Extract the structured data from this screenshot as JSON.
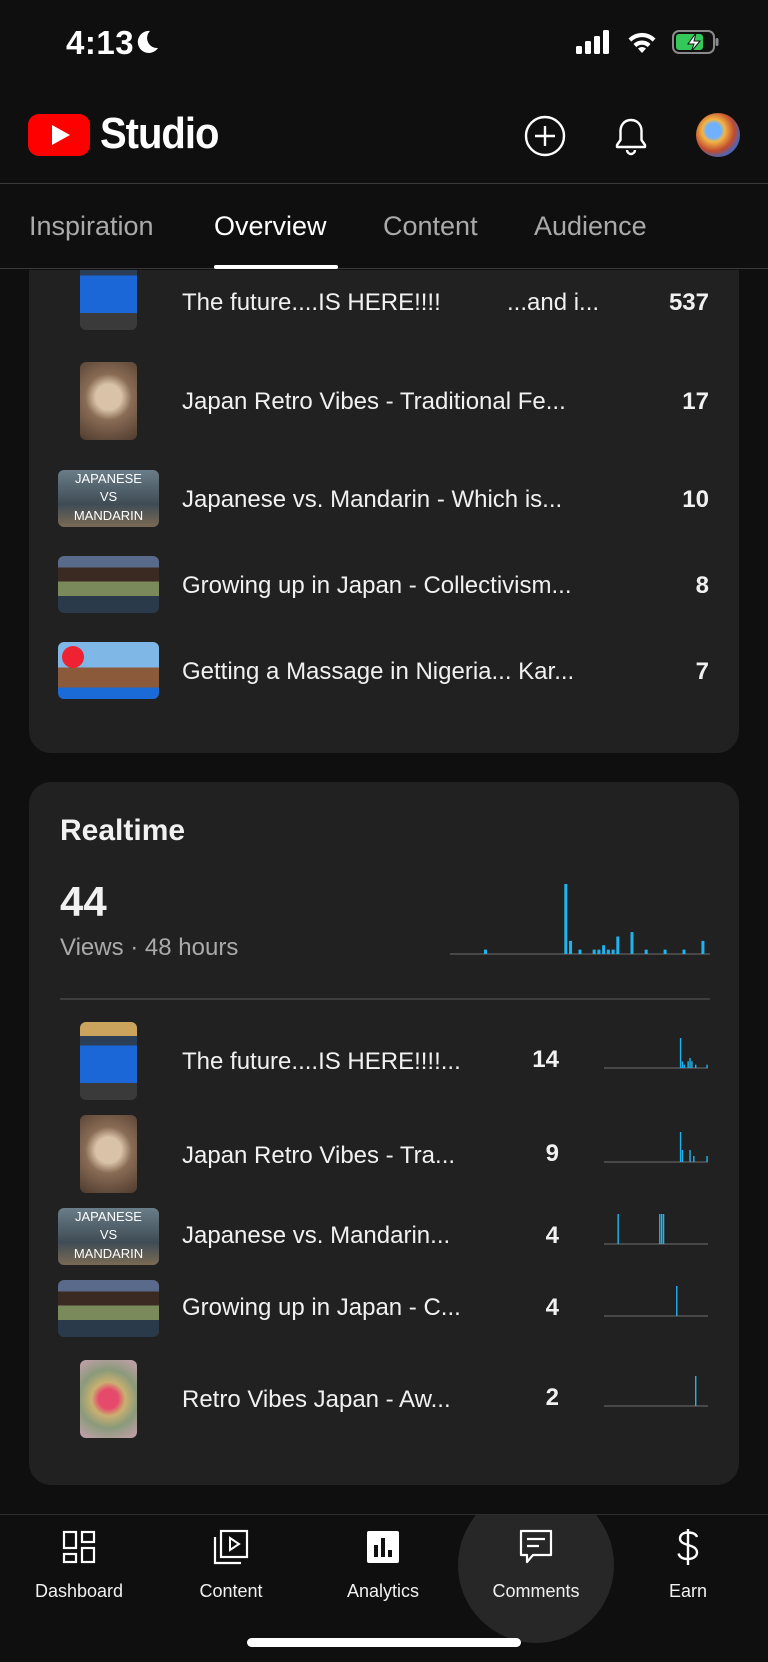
{
  "status": {
    "time": "4:13"
  },
  "app": {
    "logo_text": "Studio"
  },
  "tabs": [
    {
      "label": "Inspiration",
      "active": false
    },
    {
      "label": "Overview",
      "active": true
    },
    {
      "label": "Content",
      "active": false
    },
    {
      "label": "Audience",
      "active": false
    }
  ],
  "top_videos": [
    {
      "title": "The future....IS HERE!!!!",
      "title_suffix": "...and i...",
      "value": "537",
      "thumb": "portrait-phone"
    },
    {
      "title": "Japan Retro Vibes - Traditional Fe...",
      "value": "17",
      "thumb": "portrait-retro"
    },
    {
      "title": "Japanese vs. Mandarin - Which is...",
      "value": "10",
      "thumb": "landscape-jpvs"
    },
    {
      "title": "Growing up in Japan - Collectivism...",
      "value": "8",
      "thumb": "landscape-street"
    },
    {
      "title": "Getting a Massage in Nigeria... Kar...",
      "value": "7",
      "thumb": "landscape-nigeria"
    }
  ],
  "thumb_text": {
    "line1": "JAPANESE",
    "line2": "VS",
    "line3": "MANDARIN"
  },
  "realtime": {
    "title": "Realtime",
    "views": "44",
    "subtitle": "Views · 48 hours",
    "bars": [
      0,
      0,
      0,
      0,
      0,
      0,
      0,
      1,
      0,
      0,
      0,
      0,
      0,
      0,
      0,
      0,
      0,
      0,
      0,
      0,
      0,
      0,
      0,
      0,
      16,
      3,
      0,
      1,
      0,
      0,
      1,
      1,
      2,
      1,
      1,
      4,
      0,
      0,
      5,
      0,
      0,
      1,
      0,
      0,
      0,
      1,
      0,
      0,
      0,
      1,
      0,
      0,
      0,
      3,
      0
    ],
    "accent": "#1fb4f0",
    "videos": [
      {
        "title": "The future....IS HERE!!!!...",
        "value": "14",
        "spark": [
          0,
          0,
          0,
          0,
          0,
          0,
          0,
          0,
          0,
          0,
          0,
          0,
          0,
          0,
          0,
          0,
          0,
          0,
          0,
          0,
          0,
          0,
          0,
          0,
          0,
          0,
          0,
          0,
          0,
          0,
          0,
          0,
          0,
          0,
          0,
          0,
          0,
          0,
          0,
          0,
          9,
          2,
          1,
          0,
          2,
          3,
          2,
          0,
          1,
          0,
          0,
          0,
          0,
          0,
          1
        ],
        "thumb": "portrait-phone"
      },
      {
        "title": "Japan Retro Vibes - Tra...",
        "value": "9",
        "spark": [
          0,
          0,
          0,
          0,
          0,
          0,
          0,
          0,
          0,
          0,
          0,
          0,
          0,
          0,
          0,
          0,
          0,
          0,
          0,
          0,
          0,
          0,
          0,
          0,
          0,
          0,
          0,
          0,
          0,
          0,
          0,
          0,
          0,
          0,
          0,
          0,
          0,
          0,
          0,
          0,
          5,
          2,
          0,
          0,
          0,
          2,
          0,
          1,
          0,
          0,
          0,
          0,
          0,
          0,
          1
        ],
        "thumb": "portrait-retro"
      },
      {
        "title": "Japanese vs. Mandarin...",
        "value": "4",
        "spark": [
          0,
          0,
          0,
          0,
          0,
          0,
          0,
          1,
          0,
          0,
          0,
          0,
          0,
          0,
          0,
          0,
          0,
          0,
          0,
          0,
          0,
          0,
          0,
          0,
          0,
          0,
          0,
          0,
          0,
          1,
          1,
          1,
          0,
          0,
          0,
          0,
          0,
          0,
          0,
          0,
          0,
          0,
          0,
          0,
          0,
          0,
          0,
          0,
          0,
          0,
          0,
          0,
          0,
          0,
          0
        ],
        "thumb": "landscape-jpvs"
      },
      {
        "title": "Growing up in Japan - C...",
        "value": "4",
        "spark": [
          0,
          0,
          0,
          0,
          0,
          0,
          0,
          0,
          0,
          0,
          0,
          0,
          0,
          0,
          0,
          0,
          0,
          0,
          0,
          0,
          0,
          0,
          0,
          0,
          0,
          0,
          0,
          0,
          0,
          0,
          0,
          0,
          0,
          0,
          0,
          0,
          0,
          0,
          4,
          0,
          0,
          0,
          0,
          0,
          0,
          0,
          0,
          0,
          0,
          0,
          0,
          0,
          0,
          0,
          0
        ],
        "thumb": "landscape-street"
      },
      {
        "title": "Retro Vibes Japan  - Aw...",
        "value": "2",
        "spark": [
          0,
          0,
          0,
          0,
          0,
          0,
          0,
          0,
          0,
          0,
          0,
          0,
          0,
          0,
          0,
          0,
          0,
          0,
          0,
          0,
          0,
          0,
          0,
          0,
          0,
          0,
          0,
          0,
          0,
          0,
          0,
          0,
          0,
          0,
          0,
          0,
          0,
          0,
          0,
          0,
          0,
          0,
          0,
          0,
          0,
          0,
          0,
          0,
          2,
          0,
          0,
          0,
          0,
          0,
          0
        ],
        "thumb": "portrait-retro2"
      }
    ]
  },
  "bottom_nav": [
    {
      "label": "Dashboard",
      "icon": "dashboard-icon"
    },
    {
      "label": "Content",
      "icon": "content-icon"
    },
    {
      "label": "Analytics",
      "icon": "analytics-icon"
    },
    {
      "label": "Comments",
      "icon": "comments-icon",
      "active": true
    },
    {
      "label": "Earn",
      "icon": "dollar-icon"
    }
  ]
}
